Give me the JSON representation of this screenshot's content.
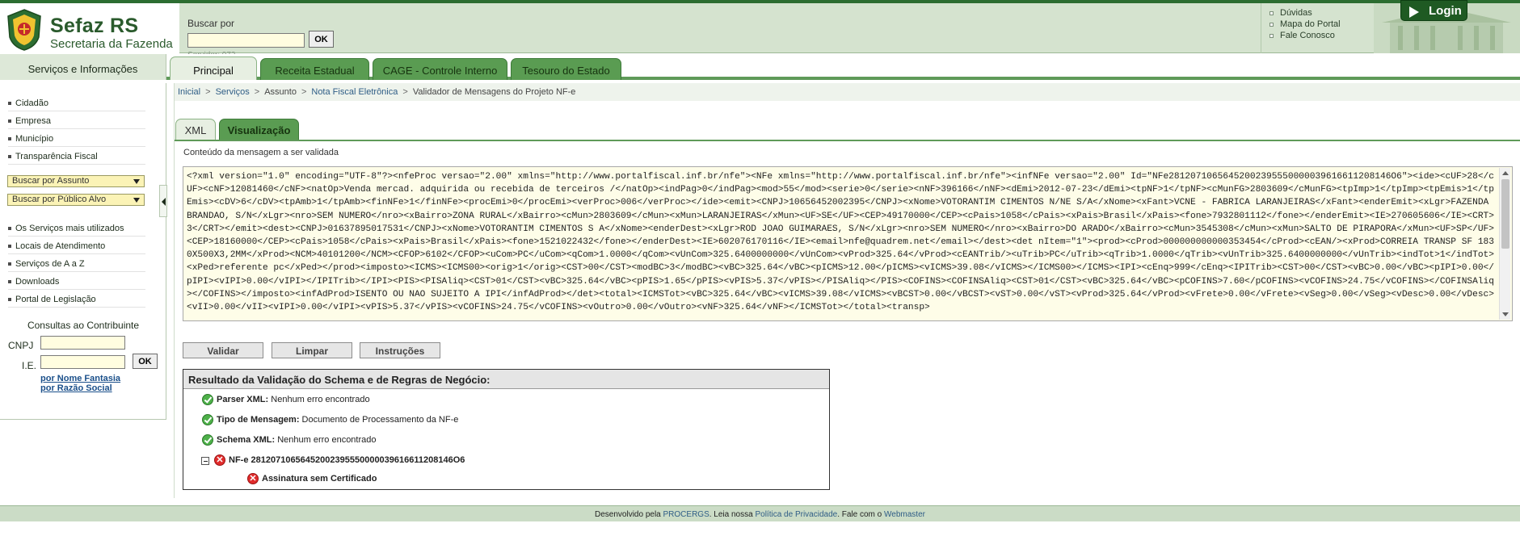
{
  "header": {
    "logo_line1": "Sefaz RS",
    "logo_line2": "Secretaria da Fazenda",
    "search_label": "Buscar por",
    "search_value": "",
    "search_ok": "OK",
    "server_text": "Servidor: 972",
    "top_links": [
      "Dúvidas",
      "Mapa do Portal",
      "Fale Conosco"
    ],
    "login_label": "Login"
  },
  "nav": {
    "left_heading": "Serviços e Informações",
    "tabs": [
      {
        "label": "Principal"
      },
      {
        "label": "Receita Estadual"
      },
      {
        "label": "CAGE - Controle Interno"
      },
      {
        "label": "Tesouro do Estado"
      }
    ]
  },
  "sidebar": {
    "group1": [
      "Cidadão",
      "Empresa",
      "Município",
      "Transparência Fiscal"
    ],
    "select1": "Buscar por Assunto",
    "select2": "Buscar por Público Alvo",
    "group2": [
      "Os Serviços mais utilizados",
      "Locais de Atendimento",
      "Serviços de A a Z",
      "Downloads",
      "Portal de Legislação"
    ],
    "consultas_heading": "Consultas ao Contribuinte",
    "cnpj_label": "CNPJ",
    "ie_label": "I.E.",
    "ok_label": "OK",
    "link_fantasia": "por Nome Fantasia",
    "link_razao": "por Razão Social"
  },
  "breadcrumb": [
    "Inicial",
    "Serviços",
    "Assunto",
    "Nota Fiscal Eletrônica",
    "Validador de Mensagens do Projeto NF-e"
  ],
  "subtabs": [
    "XML",
    "Visualização"
  ],
  "content_label": "Conteúdo da mensagem a ser validada",
  "xml_text": "<?xml version=\"1.0\" encoding=\"UTF-8\"?><nfeProc versao=\"2.00\" xmlns=\"http://www.portalfiscal.inf.br/nfe\"><NFe xmlns=\"http://www.portalfiscal.inf.br/nfe\"><infNFe versao=\"2.00\" Id=\"NFe28120710656452002395550000039616611208146O6\"><ide><cUF>28</cUF><cNF>12081460</cNF><natOp>Venda mercad. adquirida ou recebida de terceiros /</natOp><indPag>0</indPag><mod>55</mod><serie>0</serie><nNF>396166</nNF><dEmi>2012-07-23</dEmi><tpNF>1</tpNF><cMunFG>2803609</cMunFG><tpImp>1</tpImp><tpEmis>1</tpEmis><cDV>6</cDV><tpAmb>1</tpAmb><finNFe>1</finNFe><procEmi>0</procEmi><verProc>006</verProc></ide><emit><CNPJ>10656452002395</CNPJ><xNome>VOTORANTIM CIMENTOS N/NE S/A</xNome><xFant>VCNE - FABRICA LARANJEIRAS</xFant><enderEmit><xLgr>FAZENDA BRANDAO, S/N</xLgr><nro>SEM NUMERO</nro><xBairro>ZONA RURAL</xBairro><cMun>2803609</cMun><xMun>LARANJEIRAS</xMun><UF>SE</UF><CEP>49170000</CEP><cPais>1058</cPais><xPais>Brasil</xPais><fone>7932801112</fone></enderEmit><IE>270605606</IE><CRT>3</CRT></emit><dest><CNPJ>01637895017531</CNPJ><xNome>VOTORANTIM CIMENTOS S A</xNome><enderDest><xLgr>ROD JOAO GUIMARAES, S/N</xLgr><nro>SEM NUMERO</nro><xBairro>DO ARADO</xBairro><cMun>3545308</cMun><xMun>SALTO DE PIRAPORA</xMun><UF>SP</UF><CEP>18160000</CEP><cPais>1058</cPais><xPais>Brasil</xPais><fone>1521022432</fone></enderDest><IE>602076170116</IE><email>nfe@quadrem.net</email></dest><det nItem=\"1\"><prod><cProd>000000000000353454</cProd><cEAN/><xProd>CORREIA TRANSP SF 1830X500X3,2MM</xProd><NCM>40101200</NCM><CFOP>6102</CFOP><uCom>PC</uCom><qCom>1.0000</qCom><vUnCom>325.6400000000</vUnCom><vProd>325.64</vProd><cEANTrib/><uTrib>PC</uTrib><qTrib>1.0000</qTrib><vUnTrib>325.6400000000</vUnTrib><indTot>1</indTot><xPed>referente pc</xPed></prod><imposto><ICMS><ICMS00><orig>1</orig><CST>00</CST><modBC>3</modBC><vBC>325.64</vBC><pICMS>12.00</pICMS><vICMS>39.08</vICMS></ICMS00></ICMS><IPI><cEnq>999</cEnq><IPITrib><CST>00</CST><vBC>0.00</vBC><pIPI>0.00</pIPI><vIPI>0.00</vIPI></IPITrib></IPI><PIS><PISAliq><CST>01</CST><vBC>325.64</vBC><pPIS>1.65</pPIS><vPIS>5.37</vPIS></PISAliq></PIS><COFINS><COFINSAliq><CST>01</CST><vBC>325.64</vBC><pCOFINS>7.60</pCOFINS><vCOFINS>24.75</vCOFINS></COFINSAliq></COFINS></imposto><infAdProd>ISENTO OU NAO SUJEITO A IPI</infAdProd></det><total><ICMSTot><vBC>325.64</vBC><vICMS>39.08</vICMS><vBCST>0.00</vBCST><vST>0.00</vST><vProd>325.64</vProd><vFrete>0.00</vFrete><vSeg>0.00</vSeg><vDesc>0.00</vDesc><vII>0.00</vII><vIPI>0.00</vIPI><vPIS>5.37</vPIS><vCOFINS>24.75</vCOFINS><vOutro>0.00</vOutro><vNF>325.64</vNF></ICMSTot></total><transp>",
  "buttons": [
    "Validar",
    "Limpar",
    "Instruções"
  ],
  "result": {
    "heading": "Resultado da Validação do Schema e de Regras de Negócio:",
    "rows": [
      {
        "label": "Parser XML:",
        "text": "Nenhum erro encontrado"
      },
      {
        "label": "Tipo de Mensagem:",
        "text": "Documento de Processamento da NF-e"
      },
      {
        "label": "Schema XML:",
        "text": "Nenhum erro encontrado"
      }
    ],
    "nfe_label": "NF-e 28120710656452002395550000039616611208146O6",
    "error_text": "Assinatura sem Certificado",
    "error_symbol": "✕"
  },
  "footer": {
    "prefix": "Desenvolvido pela ",
    "procergs": "PROCERGS",
    "mid": ". Leia nossa ",
    "privacy": "Política de Privacidade",
    "mid2": ". Fale com o ",
    "webmaster": "Webmaster"
  }
}
